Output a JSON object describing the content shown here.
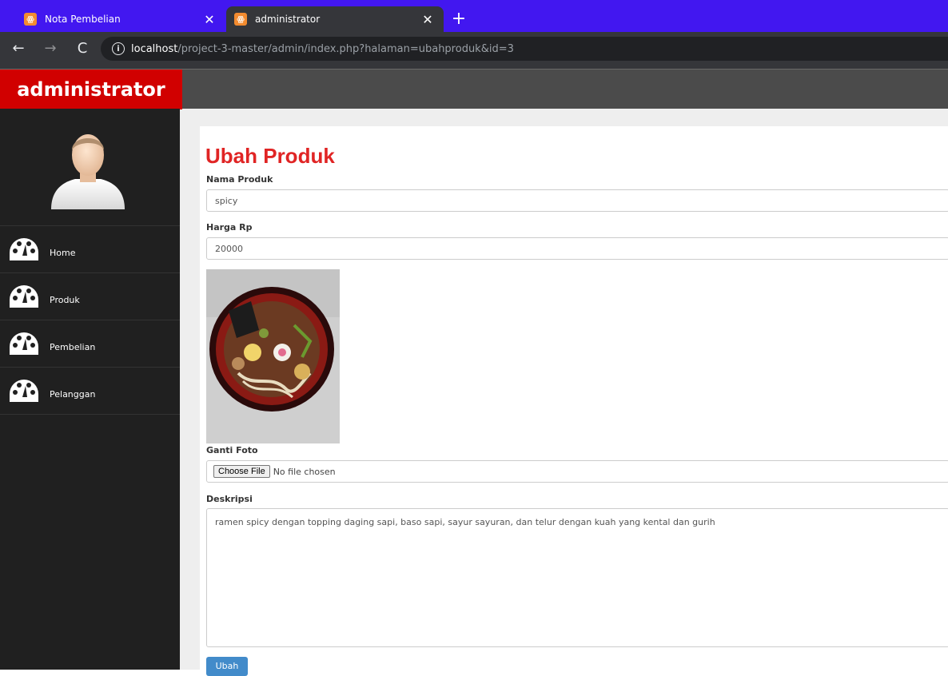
{
  "browser": {
    "tabs": [
      {
        "title": "Nota Pembelian",
        "icon": "xampp-icon"
      },
      {
        "title": "administrator",
        "icon": "xampp-icon"
      }
    ],
    "new_tab": "+",
    "url_host": "localhost",
    "url_path": "/project-3-master/admin/index.php?halaman=ubahproduk&id=3"
  },
  "app": {
    "brand": "administrator",
    "nav": [
      {
        "label": "Home"
      },
      {
        "label": "Produk"
      },
      {
        "label": "Pembelian"
      },
      {
        "label": "Pelanggan"
      }
    ]
  },
  "form": {
    "title": "Ubah Produk",
    "nama_label": "Nama Produk",
    "nama_value": "spicy",
    "harga_label": "Harga Rp",
    "harga_value": "20000",
    "foto_label": "Ganti Foto",
    "file_button": "Choose File",
    "file_status": "No file chosen",
    "deskripsi_label": "Deskripsi",
    "deskripsi_value": "ramen spicy dengan topping daging sapi, baso sapi, sayur sayuran, dan telur dengan kuah yang kental dan gurih",
    "submit_label": "Ubah"
  },
  "colors": {
    "tabbar": "#4217f0",
    "brand": "#d10000",
    "title": "#e02424",
    "button": "#428bca"
  }
}
